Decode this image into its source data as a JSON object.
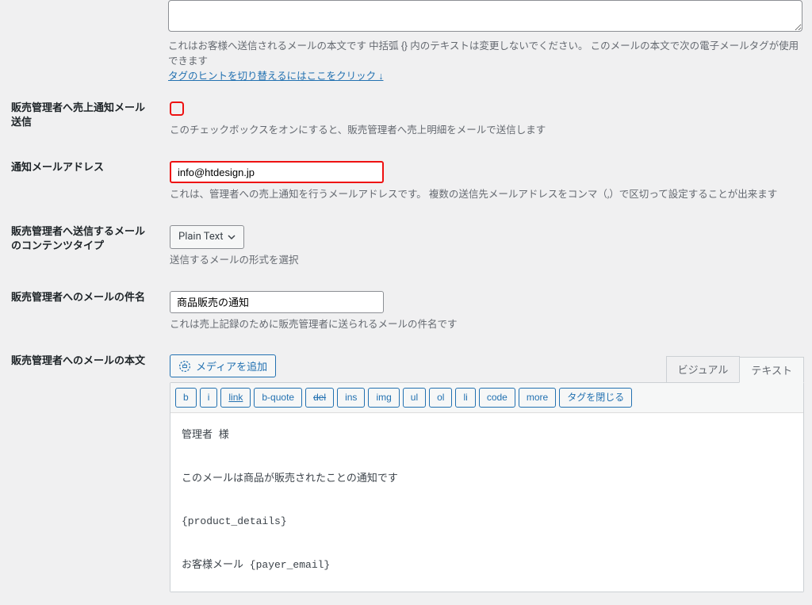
{
  "top": {
    "desc1": "これはお客様へ送信されるメールの本文です 中括弧 {} 内のテキストは変更しないでください。 このメールの本文で次の電子メールタグが使用できます",
    "toggle_link": "タグのヒントを切り替えるにはここをクリック ↓"
  },
  "sales_notify": {
    "label": "販売管理者へ売上通知メール送信",
    "desc": "このチェックボックスをオンにすると、販売管理者へ売上明細をメールで送信します"
  },
  "notify_email": {
    "label": "通知メールアドレス",
    "value": "info@htdesign.jp",
    "desc": "これは、管理者への売上通知を行うメールアドレスです。 複数の送信先メールアドレスをコンマ（,）で区切って設定することが出来ます"
  },
  "content_type": {
    "label": "販売管理者へ送信するメールのコンテンツタイプ",
    "value": "Plain Text",
    "desc": "送信するメールの形式を選択"
  },
  "subject": {
    "label": "販売管理者へのメールの件名",
    "value": "商品販売の通知",
    "desc": "これは売上記録のために販売管理者に送られるメールの件名です"
  },
  "body": {
    "label": "販売管理者へのメールの本文",
    "media_btn": "メディアを追加",
    "tabs": {
      "visual": "ビジュアル",
      "text": "テキスト"
    },
    "qt": {
      "b": "b",
      "i": "i",
      "link": "link",
      "bquote": "b-quote",
      "del": "del",
      "ins": "ins",
      "img": "img",
      "ul": "ul",
      "ol": "ol",
      "li": "li",
      "code": "code",
      "more": "more",
      "close": "タグを閉じる"
    },
    "content": "管理者 様\n\nこのメールは商品が販売されたことの通知です\n\n{product_details}\n\nお客様メール {payer_email}"
  }
}
